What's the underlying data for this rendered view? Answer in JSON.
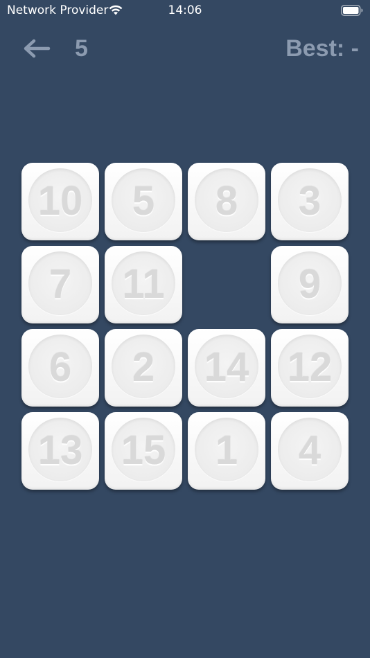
{
  "status_bar": {
    "carrier": "Network Provider",
    "time": "14:06",
    "wifi_icon": "wifi-icon",
    "battery_icon": "battery-icon"
  },
  "header": {
    "back_icon": "arrow-left-icon",
    "moves": "5",
    "best_label": "Best: -"
  },
  "board": {
    "size": 4,
    "tiles": [
      [
        "10",
        "5",
        "8",
        "3"
      ],
      [
        "7",
        "11",
        "",
        "9"
      ],
      [
        "6",
        "2",
        "14",
        "12"
      ],
      [
        "13",
        "15",
        "1",
        "4"
      ]
    ]
  },
  "colors": {
    "background": "#344862",
    "header_text": "#8c9bb0",
    "tile": "#f7f7f7",
    "tile_number": "#d9d9d9"
  }
}
